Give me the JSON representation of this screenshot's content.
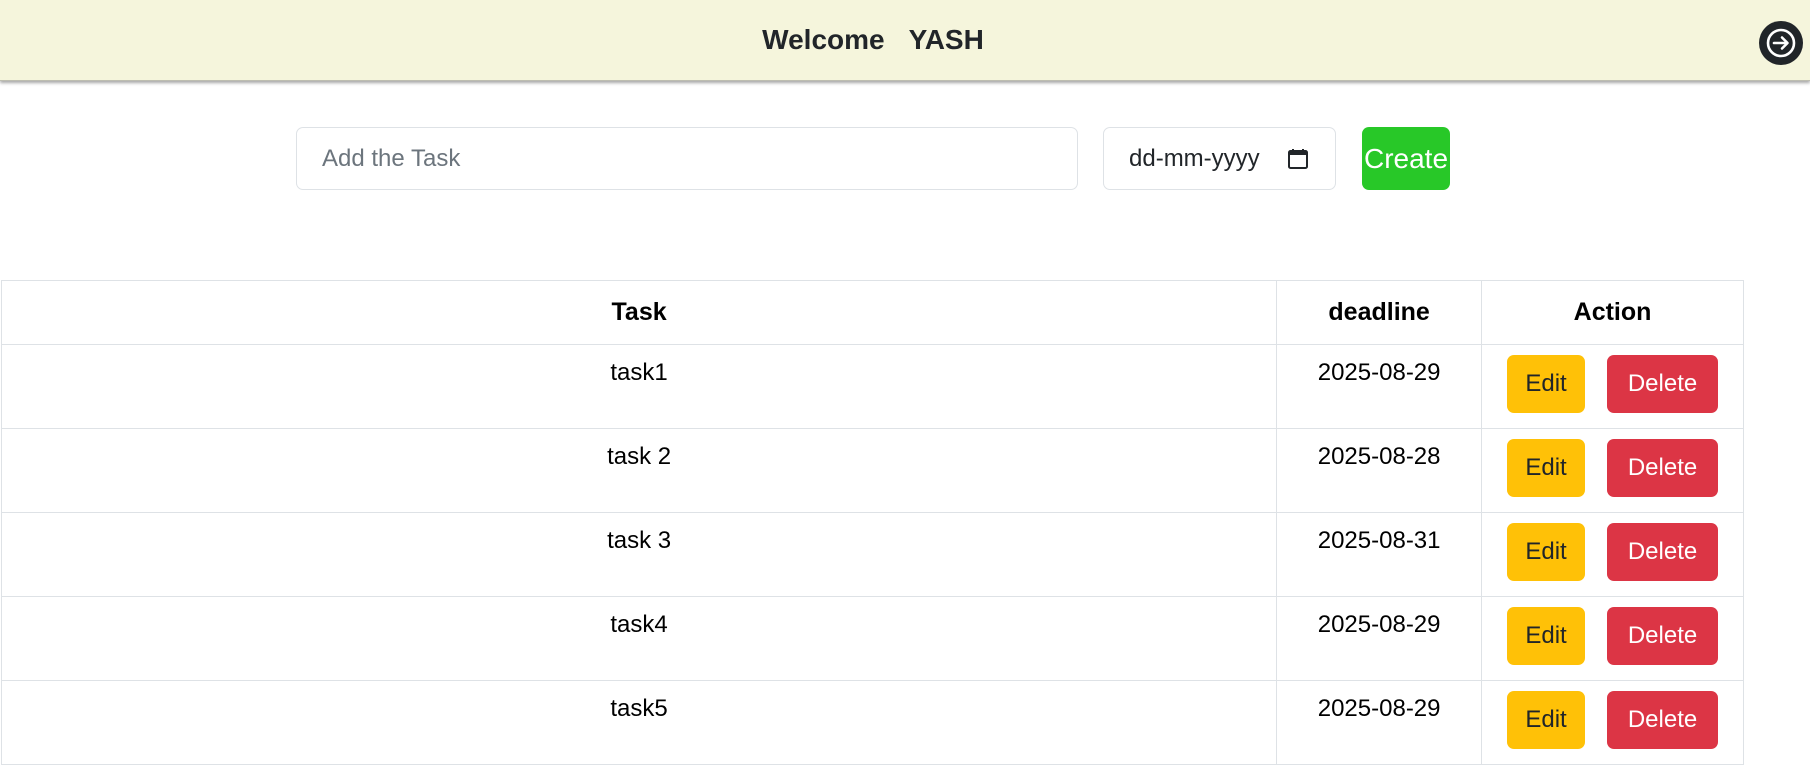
{
  "header": {
    "welcome_label": "Welcome",
    "username": "YASH",
    "logout_icon": "arrow-right-circle-icon",
    "background": "#f5f5dc"
  },
  "form": {
    "task_placeholder": "Add the Task",
    "task_value": "",
    "date_placeholder": "dd-mm-yyyy",
    "calendar_icon": "calendar-icon",
    "create_label": "Create",
    "create_color": "#28c828"
  },
  "table": {
    "columns": [
      "Task",
      "deadline",
      "Action"
    ],
    "rows": [
      {
        "task": "task1",
        "deadline": "2025-08-29"
      },
      {
        "task": "task 2",
        "deadline": "2025-08-28"
      },
      {
        "task": "task 3",
        "deadline": "2025-08-31"
      },
      {
        "task": "task4",
        "deadline": "2025-08-29"
      },
      {
        "task": "task5",
        "deadline": "2025-08-29"
      }
    ],
    "edit_label": "Edit",
    "delete_label": "Delete",
    "edit_color": "#ffc107",
    "delete_color": "#dc3545"
  }
}
